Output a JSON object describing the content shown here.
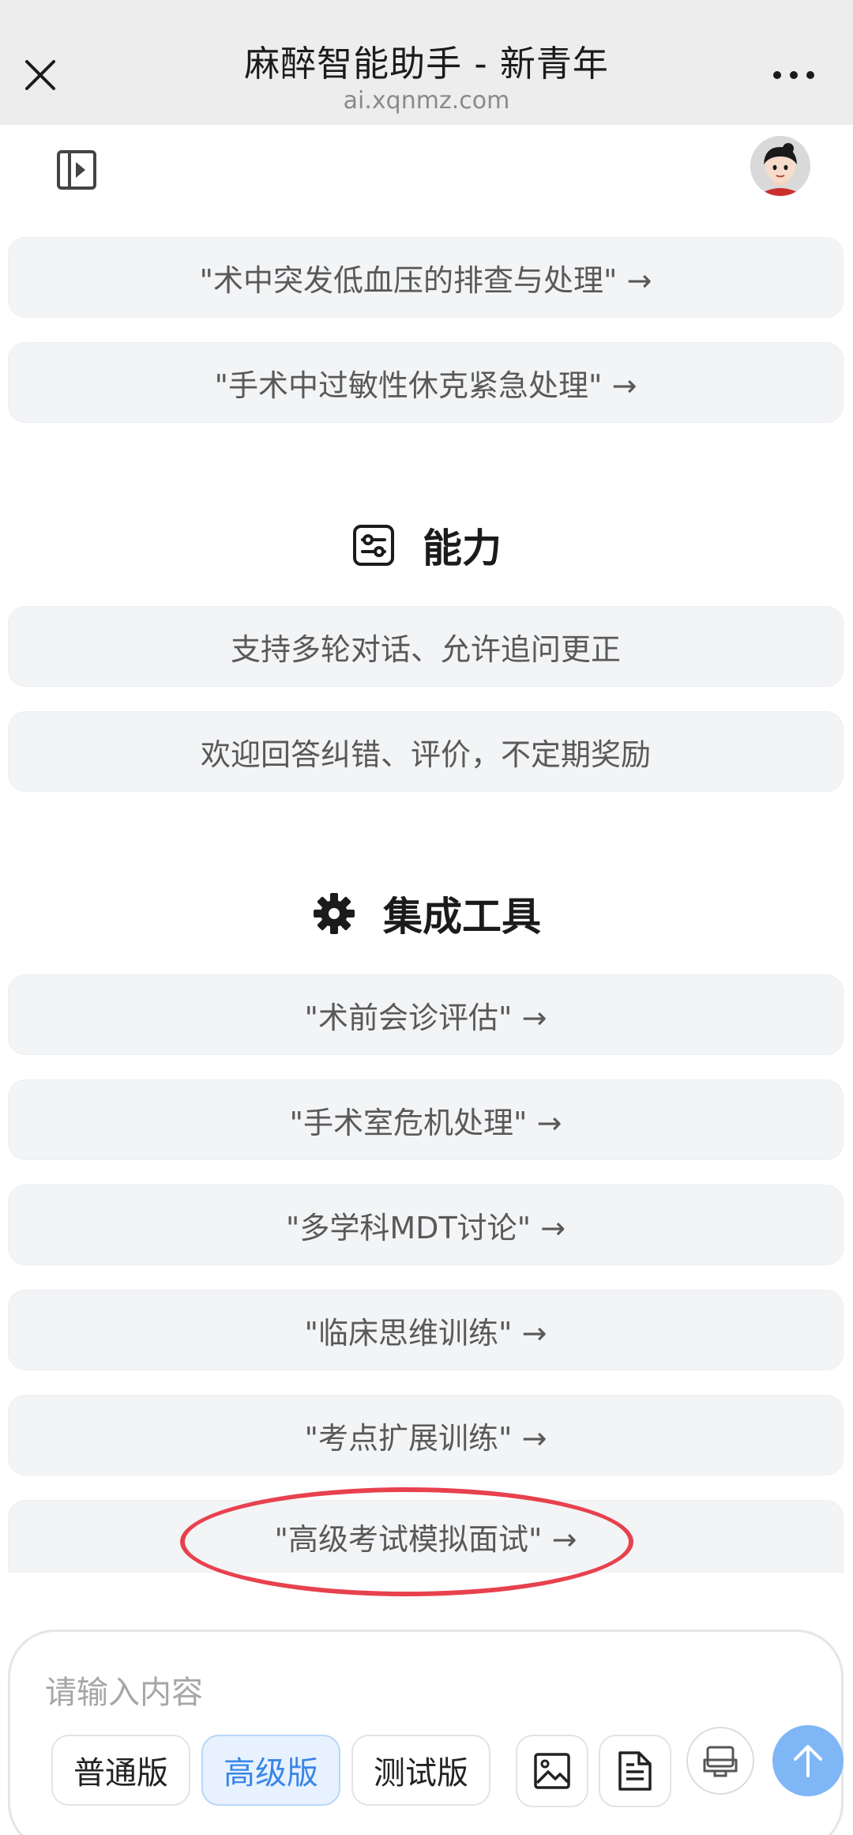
{
  "topbar": {
    "title": "麻醉智能助手 - 新青年",
    "url": "ai.xqnmz.com"
  },
  "icons": {
    "close": "close-icon",
    "more": "more-icon",
    "sidebar": "sidebar-toggle-icon",
    "capabilities": "sliders-icon",
    "tools": "gear-icon"
  },
  "examples": [
    "\"术中突发低血压的排查与处理\" →",
    "\"手术中过敏性休克紧急处理\" →"
  ],
  "capabilities": {
    "title": "能力",
    "items": [
      "支持多轮对话、允许追问更正",
      "欢迎回答纠错、评价，不定期奖励"
    ]
  },
  "tools": {
    "title": "集成工具",
    "items": [
      "\"术前会诊评估\" →",
      "\"手术室危机处理\" →",
      "\"多学科MDT讨论\" →",
      "\"临床思维训练\" →",
      "\"考点扩展训练\" →",
      "\"高级考试模拟面试\" →"
    ]
  },
  "input": {
    "placeholder": "请输入内容",
    "modes": [
      "普通版",
      "高级版",
      "测试版"
    ],
    "active_mode": "高级版"
  },
  "colors": {
    "accent": "#3a86e8",
    "send": "#7fb6f5",
    "highlight": "#e8414e"
  }
}
